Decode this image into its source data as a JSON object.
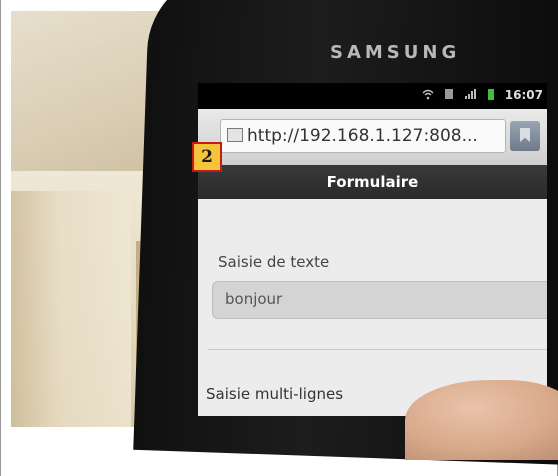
{
  "device": {
    "brand": "SAMSUNG"
  },
  "status_bar": {
    "time": "16:07",
    "icons": [
      "wifi-icon",
      "sim-icon",
      "signal-icon",
      "battery-icon"
    ]
  },
  "browser": {
    "url": "http://192.168.1.127:808...",
    "icons": [
      "page-icon",
      "bookmark-icon"
    ]
  },
  "page": {
    "title": "Formulaire",
    "fields": [
      {
        "label": "Saisie de texte",
        "value": "bonjour"
      },
      {
        "label": "Saisie multi-lignes"
      }
    ]
  },
  "annotation": {
    "marker_number": "2"
  },
  "colors": {
    "marker_bg": "#f5c43a",
    "marker_border": "#c41a1a",
    "header_bg": "#2f2f2f"
  }
}
